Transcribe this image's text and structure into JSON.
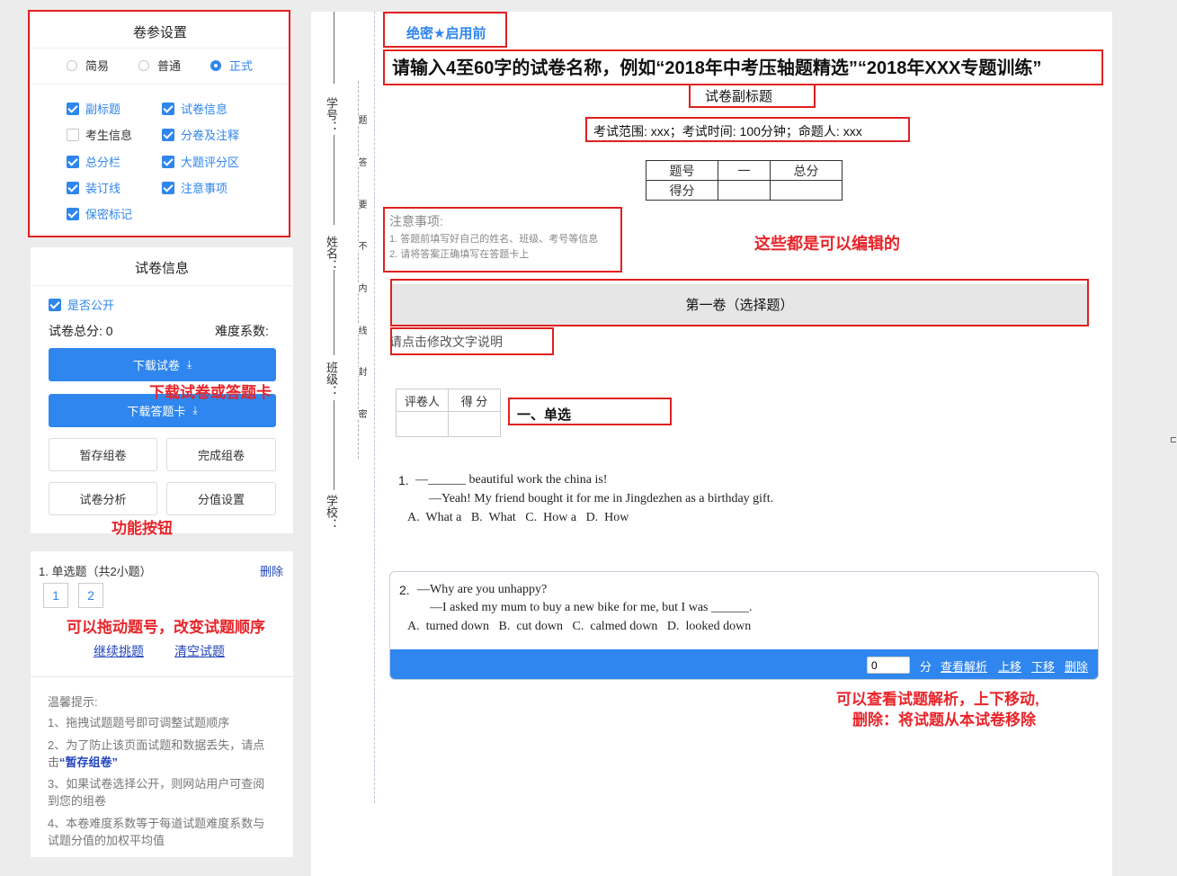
{
  "settings": {
    "title": "卷参设置",
    "modes": [
      {
        "label": "简易",
        "selected": false
      },
      {
        "label": "普通",
        "selected": false
      },
      {
        "label": "正式",
        "selected": true
      }
    ],
    "options": [
      {
        "label": "副标题",
        "checked": true
      },
      {
        "label": "试卷信息",
        "checked": true
      },
      {
        "label": "考生信息",
        "checked": false
      },
      {
        "label": "分卷及注释",
        "checked": true
      },
      {
        "label": "总分栏",
        "checked": true
      },
      {
        "label": "大题评分区",
        "checked": true
      },
      {
        "label": "装订线",
        "checked": true
      },
      {
        "label": "注意事项",
        "checked": true
      },
      {
        "label": "保密标记",
        "checked": true
      }
    ]
  },
  "info": {
    "title": "试卷信息",
    "public_label": "是否公开",
    "total_score": "试卷总分: 0",
    "difficulty": "难度系数:",
    "download_paper": "下载试卷",
    "download_card": "下载答题卡",
    "save_draft": "暂存组卷",
    "finish": "完成组卷",
    "analysis": "试卷分析",
    "score_setting": "分值设置",
    "annot_download": "下载试卷或答题卡",
    "annot_func": "功能按钮"
  },
  "questions_panel": {
    "section": "1. 单选题（共2小题）",
    "delete": "删除",
    "numbers": [
      "1",
      "2"
    ],
    "annot_drag": "可以拖动题号，改变试题顺序",
    "continue": "继续挑题",
    "clear": "清空试题",
    "tips_title": "温馨提示:",
    "tip1": "1、拖拽试题题号即可调整试题顺序",
    "tip2a": "2、为了防止该页面试题和数据丢失，请点击",
    "tip2b": "“暂存组卷”",
    "tip3": "3、如果试卷选择公开，则网站用户可查阅到您的组卷",
    "tip4": "4、本卷难度系数等于每道试题难度系数与试题分值的加权平均值"
  },
  "binding": {
    "labels": [
      "学号：",
      "姓名：",
      "班级：",
      "学校："
    ],
    "seal_chars": [
      "题",
      "答",
      "要",
      "不",
      "内",
      "线",
      "封",
      "密"
    ]
  },
  "paper": {
    "secret_mark": "绝密★启用前",
    "title": "请输入4至60字的试卷名称，例如“2018年中考压轴题精选”“2018年XXX专题训练”",
    "subtitle": "试卷副标题",
    "exam_info": "考试范围: xxx；考试时间: 100分钟；命题人: xxx",
    "score_table": {
      "row1": [
        "题号",
        "一",
        "总分"
      ],
      "row2": [
        "得分",
        "",
        ""
      ]
    },
    "notice_title": "注意事项:",
    "notice1": "1.  答题前填写好自己的姓名、班级、考号等信息",
    "notice2": "2.  请将答案正确填写在答题卡上",
    "annot_editable": "这些都是可以编辑的",
    "volume": "第一卷（选择题）",
    "volume_desc": "请点击修改文字说明",
    "grader": "评卷人",
    "score": "得 分",
    "section": "一、单选",
    "q1": {
      "num": "1.",
      "line1": "—______ beautiful work the china is!",
      "line2": "—Yeah! My friend bought it for me in Jingdezhen as a birthday gift.",
      "options": "A.  What a   B.  What   C.  How a   D.  How"
    },
    "q2": {
      "num": "2.",
      "line1": "—Why are you unhappy?",
      "line2": "—I asked my mum to buy a new bike for me, but I was ______.",
      "options": "A.  turned down   B.  cut down   C.  calmed down   D.  looked down"
    },
    "toolbar": {
      "score_value": "0",
      "unit": "分",
      "view": "查看解析",
      "up": "上移",
      "down": "下移",
      "delete": "删除"
    },
    "annot_actions1": "可以查看试题解析，上下移动,",
    "annot_actions2": "删除：将试题从本试卷移除"
  }
}
